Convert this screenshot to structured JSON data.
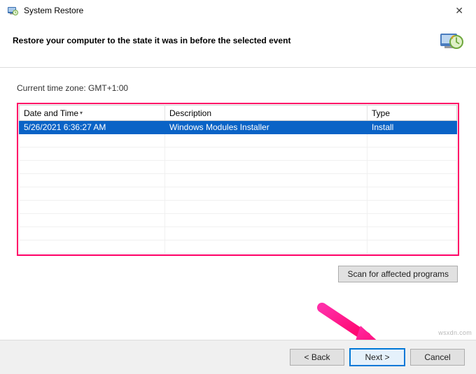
{
  "titlebar": {
    "title": "System Restore"
  },
  "header": {
    "heading": "Restore your computer to the state it was in before the selected event"
  },
  "content": {
    "timezone_label": "Current time zone: GMT+1:00",
    "columns": {
      "date": "Date and Time",
      "desc": "Description",
      "type": "Type"
    },
    "rows": [
      {
        "date": "5/26/2021 6:36:27 AM",
        "desc": "Windows Modules Installer",
        "type": "Install"
      }
    ],
    "scan_button": "Scan for affected programs"
  },
  "footer": {
    "back": "< Back",
    "next": "Next >",
    "cancel": "Cancel"
  },
  "watermark": "wsxdn.com"
}
